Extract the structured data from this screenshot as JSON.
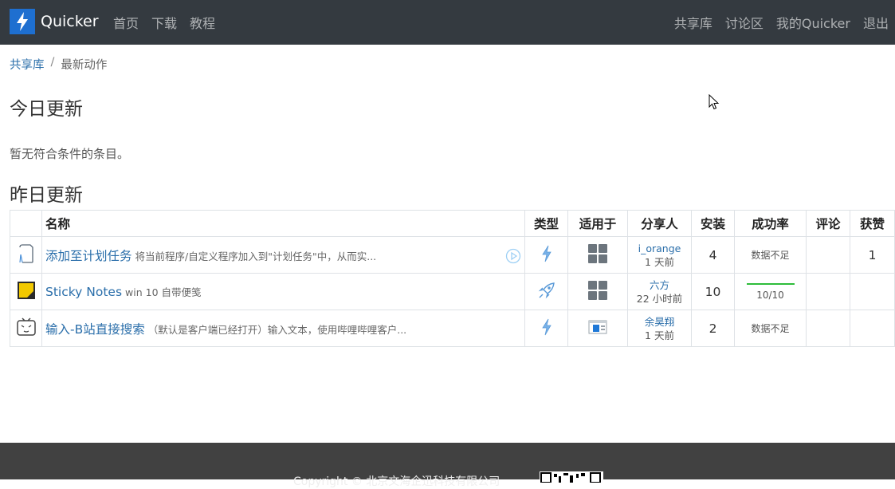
{
  "navbar": {
    "brand": "Quicker",
    "left_links": [
      "首页",
      "下载",
      "教程"
    ],
    "right_links": [
      "共享库",
      "讨论区",
      "我的Quicker",
      "退出"
    ],
    "colors": {
      "background": "#343a40",
      "logo": "#1e6fd0"
    }
  },
  "breadcrumb": {
    "link": "共享库",
    "separator": "/",
    "current": "最新动作"
  },
  "today": {
    "heading": "今日更新",
    "empty_message": "暂无符合条件的条目。"
  },
  "yesterday": {
    "heading": "昨日更新",
    "columns": {
      "name": "名称",
      "type": "类型",
      "applies_to": "适用于",
      "sharer": "分享人",
      "installs": "安装",
      "success_rate": "成功率",
      "comments": "评论",
      "likes": "获赞"
    },
    "rows": [
      {
        "icon": "document-icon",
        "title": "添加至计划任务",
        "description": "将当前程序/自定义程序加入到\"计划任务\"中，从而实...",
        "type_icon": "lightning-icon",
        "applies_icon": "windows-grid-icon",
        "sharer": "i_orange",
        "time": "1 天前",
        "installs": "4",
        "success_rate": "数据不足",
        "comments": "",
        "likes": "1"
      },
      {
        "icon": "sticky-note-icon",
        "title": "Sticky Notes",
        "description": "win 10 自带便笺",
        "type_icon": "rocket-icon",
        "applies_icon": "windows-grid-icon",
        "sharer": "六方",
        "time": "22 小时前",
        "installs": "10",
        "success_rate": "10/10",
        "success_fraction": 1.0,
        "comments": "",
        "likes": ""
      },
      {
        "icon": "bilibili-tv-icon",
        "title": "输入-B站直接搜索",
        "description": "（默认是客户端已经打开）输入文本，使用哔哩哔哩客户...",
        "type_icon": "lightning-icon",
        "applies_icon": "app-window-icon",
        "sharer": "余昊翔",
        "time": "1 天前",
        "installs": "2",
        "success_rate": "数据不足",
        "comments": "",
        "likes": ""
      }
    ]
  },
  "footer": {
    "copyright": "Copyright © 北京文海企迅科技有限公司"
  }
}
